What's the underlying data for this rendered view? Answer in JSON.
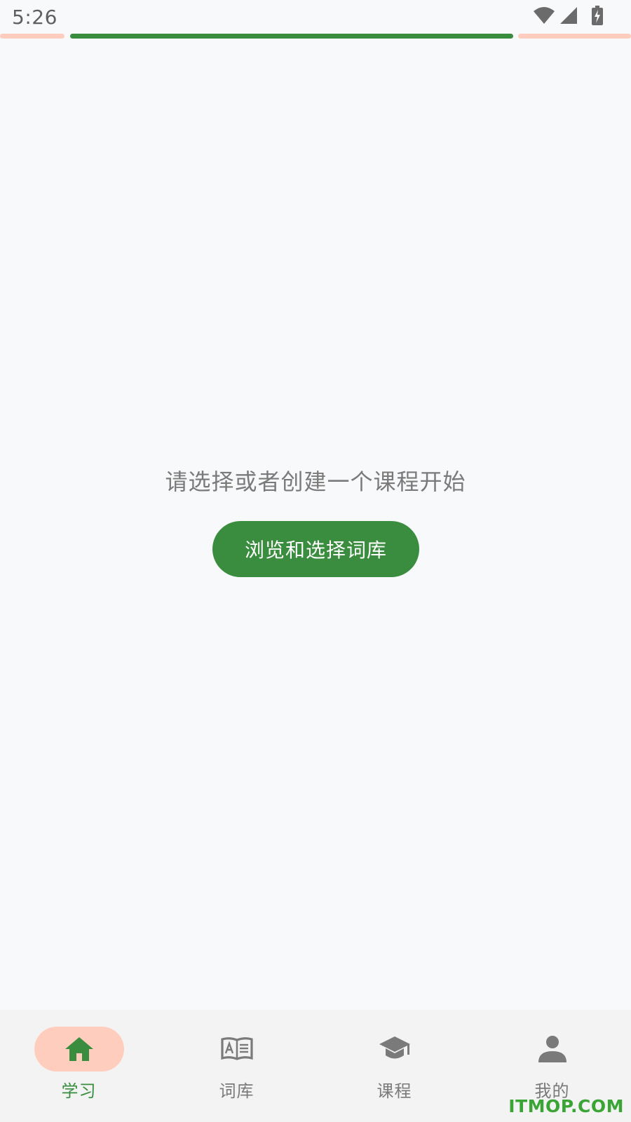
{
  "status_bar": {
    "time": "5:26",
    "icons": [
      "wifi-icon",
      "cellular-signal-icon",
      "battery-charging-icon"
    ]
  },
  "colors": {
    "accent": "#3a8d3e",
    "accent_soft": "#ffcdbd",
    "text_muted": "#7a7a7a",
    "background": "#f8f9fb",
    "nav_background": "#f3f3f4"
  },
  "main": {
    "prompt": "请选择或者创建一个课程开始",
    "browse_button_label": "浏览和选择词库"
  },
  "bottom_nav": {
    "items": [
      {
        "label": "学习",
        "icon": "home-icon",
        "active": true
      },
      {
        "label": "词库",
        "icon": "dictionary-book-icon",
        "active": false
      },
      {
        "label": "课程",
        "icon": "graduation-cap-icon",
        "active": false
      },
      {
        "label": "我的",
        "icon": "person-icon",
        "active": false
      }
    ]
  },
  "watermark": "ITMOP.COM"
}
